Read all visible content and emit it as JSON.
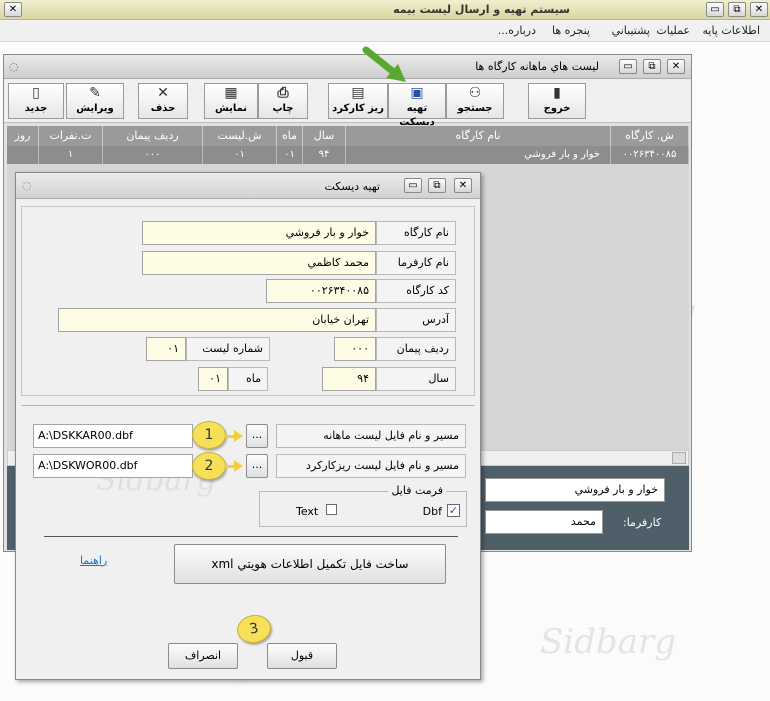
{
  "app": {
    "title": "سيستم تهيه و ارسال ليست بيمه",
    "menu": [
      "اطلاعات پايه",
      "عمليات",
      "پشتيباني",
      "پنجره ها",
      "درباره..."
    ]
  },
  "child_window": {
    "title": "ليست هاي ماهانه کارگاه ها",
    "toolbar": [
      {
        "label": "خروج",
        "icon": "exit-icon"
      },
      {
        "label": "جستجو",
        "icon": "binoculars-icon"
      },
      {
        "label": "تهيه ديسکت",
        "icon": "disk-icon"
      },
      {
        "label": "ريز کارکرد",
        "icon": "details-icon"
      },
      {
        "label": "چاپ",
        "icon": "print-icon"
      },
      {
        "label": "نمايش",
        "icon": "view-icon"
      },
      {
        "label": "حذف",
        "icon": "delete-icon"
      },
      {
        "label": "ويرايش",
        "icon": "edit-icon"
      },
      {
        "label": "جديد",
        "icon": "new-icon"
      }
    ],
    "grid": {
      "headers": [
        "ش. کارگاه",
        "نام کارگاه",
        "سال",
        "ماه",
        "ش.ليست",
        "رديف پيمان",
        "ت.نفرات",
        "روز"
      ],
      "row": [
        "۰۰۲۶۳۴۰۰۸۵",
        "خوار و بار فروشي",
        "۹۴",
        "۰۱",
        "۰۱",
        "۰۰۰",
        "۱",
        ""
      ]
    },
    "lower": {
      "workshop_value": "خوار و بار فروشي",
      "employer_label": "کارفرما:",
      "employer_value": "محمد"
    }
  },
  "dialog": {
    "title": "تهيه ديسکت",
    "fields": {
      "workshop_name": {
        "label": "نام کارگاه",
        "value": "خوار و بار فروشي"
      },
      "employer_name": {
        "label": "نام کارفرما",
        "value": "محمد کاظمي"
      },
      "workshop_code": {
        "label": "کد کارگاه",
        "value": "۰۰۲۶۳۴۰۰۸۵"
      },
      "address": {
        "label": "آدرس",
        "value": "تهران خيابان"
      },
      "contract_row": {
        "label": "رديف پيمان",
        "value": "۰۰۰"
      },
      "list_number": {
        "label": "شماره ليست",
        "value": "۰۱"
      },
      "year": {
        "label": "سال",
        "value": "۹۴"
      },
      "month": {
        "label": "ماه",
        "value": "۰۱"
      }
    },
    "monthly_path": {
      "label": "مسير و نام فايل ليست ماهانه",
      "value": "A:\\DSKKAR00.dbf"
    },
    "details_path": {
      "label": "مسير و نام فايل ليست ريزکارکرد",
      "value": "A:\\DSKWOR00.dbf"
    },
    "browse_label": "...",
    "format": {
      "legend": "فرمت فايل",
      "dbf": "Dbf",
      "text": "Text",
      "dbf_checked": true,
      "text_checked": false
    },
    "help_link": "راهنما",
    "xml_button": "ساخت فايل تکميل اطلاعات هويتي  xml",
    "ok_button": "قبول",
    "cancel_button": "انصراف"
  },
  "annotations": [
    "1",
    "2",
    "3"
  ],
  "watermark": "Sidbarg",
  "colors": {
    "field_bg": "#fffce5",
    "badge": "#f6e05a",
    "arrow_green": "#5aa832",
    "lower_panel": "#4e5f6a"
  }
}
